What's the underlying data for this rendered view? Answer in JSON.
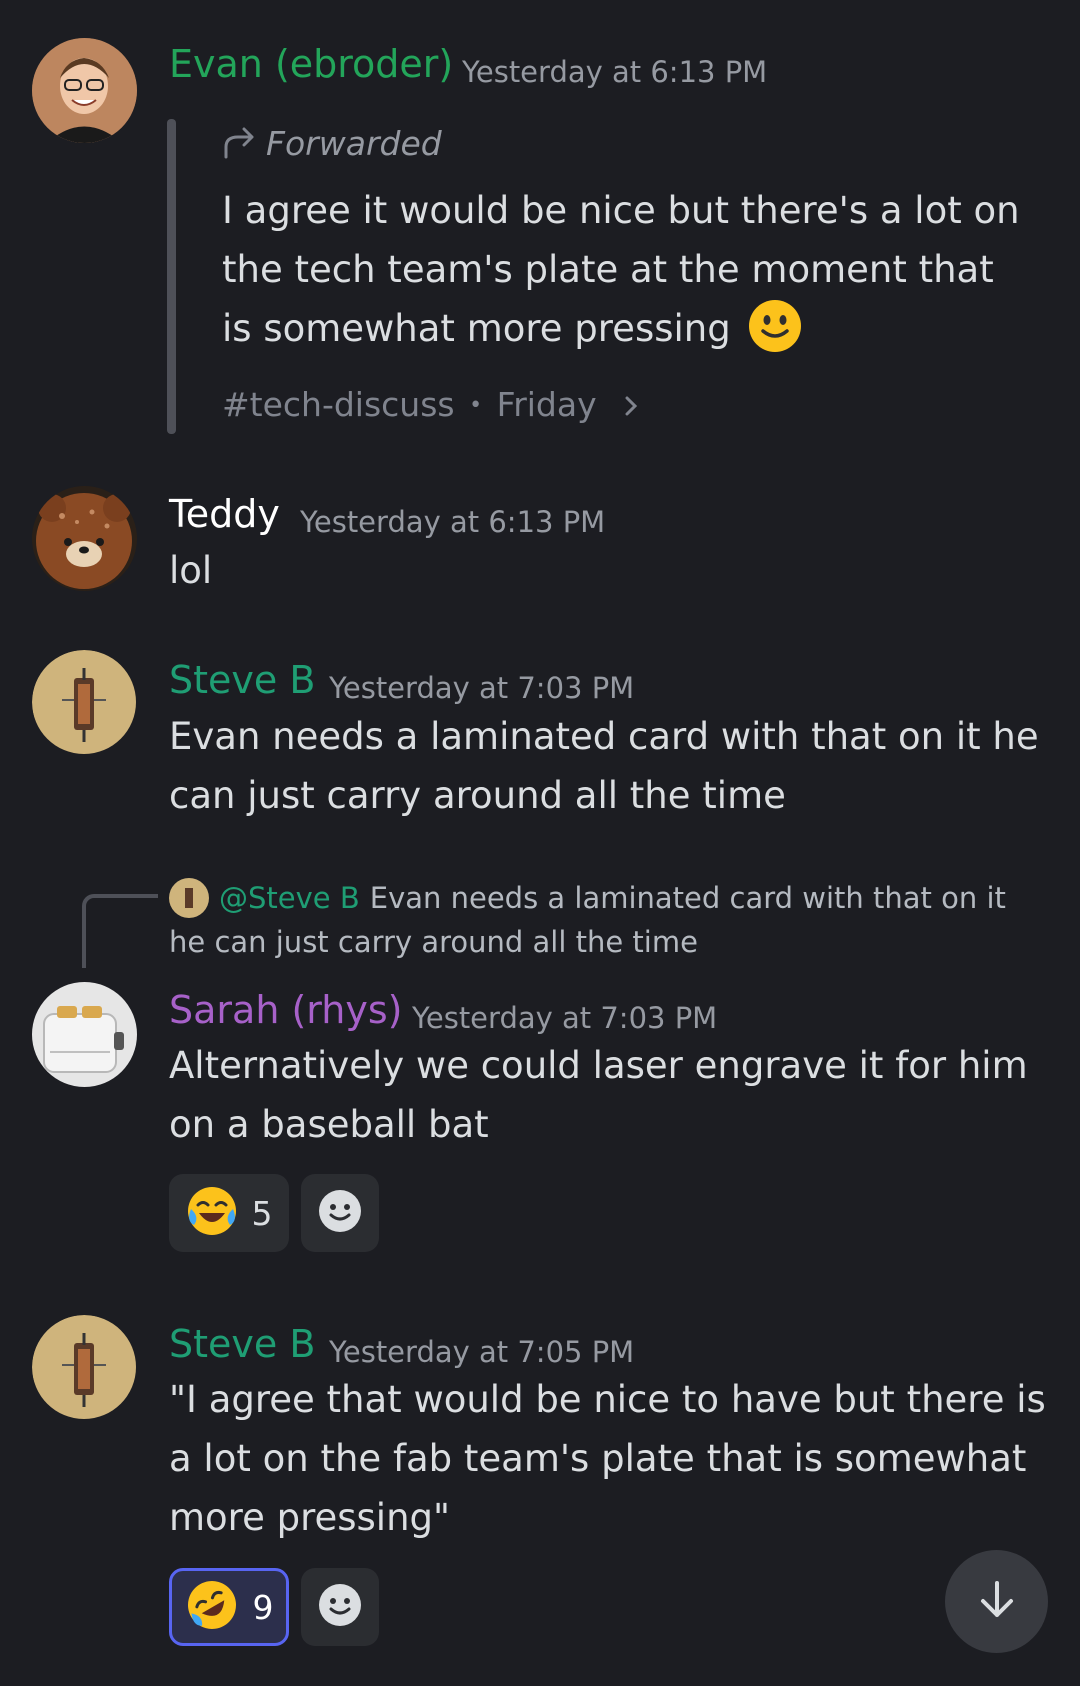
{
  "messages": {
    "m1": {
      "author": "Evan (ebroder)",
      "author_color": "#23a55a",
      "timestamp": "Yesterday at 6:13 PM",
      "forwarded_label": "Forwarded",
      "text": "I agree it would be nice but there's a lot on the tech team's plate at the moment that is somewhat more pressing",
      "channel": "#tech-discuss",
      "separator": "•",
      "day": "Friday"
    },
    "m2": {
      "author": "Teddy",
      "author_color": "#ffffff",
      "timestamp": "Yesterday at 6:13 PM",
      "text": "lol"
    },
    "m3": {
      "author": "Steve B",
      "author_color": "#1f9e74",
      "timestamp": "Yesterday at 7:03 PM",
      "text": "Evan needs a laminated card with that on it he can just carry around all the time"
    },
    "m4": {
      "reply_mention": "@Steve B",
      "reply_text": "Evan needs a laminated card with that on it he can just carry around all the time",
      "author": "Sarah (rhys)",
      "author_color": "#a761c9",
      "timestamp": "Yesterday at 7:03 PM",
      "text": "Alternatively we could laser engrave it for him on a baseball bat",
      "reaction_emoji": "joy",
      "reaction_count": "5"
    },
    "m5": {
      "author": "Steve B",
      "author_color": "#1f9e74",
      "timestamp": "Yesterday at 7:05 PM",
      "text": "\"I agree that would be nice to have but there is a lot on the fab team's plate that is somewhat more pressing\"",
      "reaction_emoji": "rofl",
      "reaction_count": "9"
    }
  },
  "icons": {
    "forward": "forward-arrow-icon",
    "chevron": "chevron-right-icon",
    "add_reaction": "add-reaction-icon",
    "scroll_down": "arrow-down-icon"
  },
  "colors": {
    "background": "#1c1d22",
    "accent": "#5865f2",
    "mention": "#1f9e74"
  }
}
